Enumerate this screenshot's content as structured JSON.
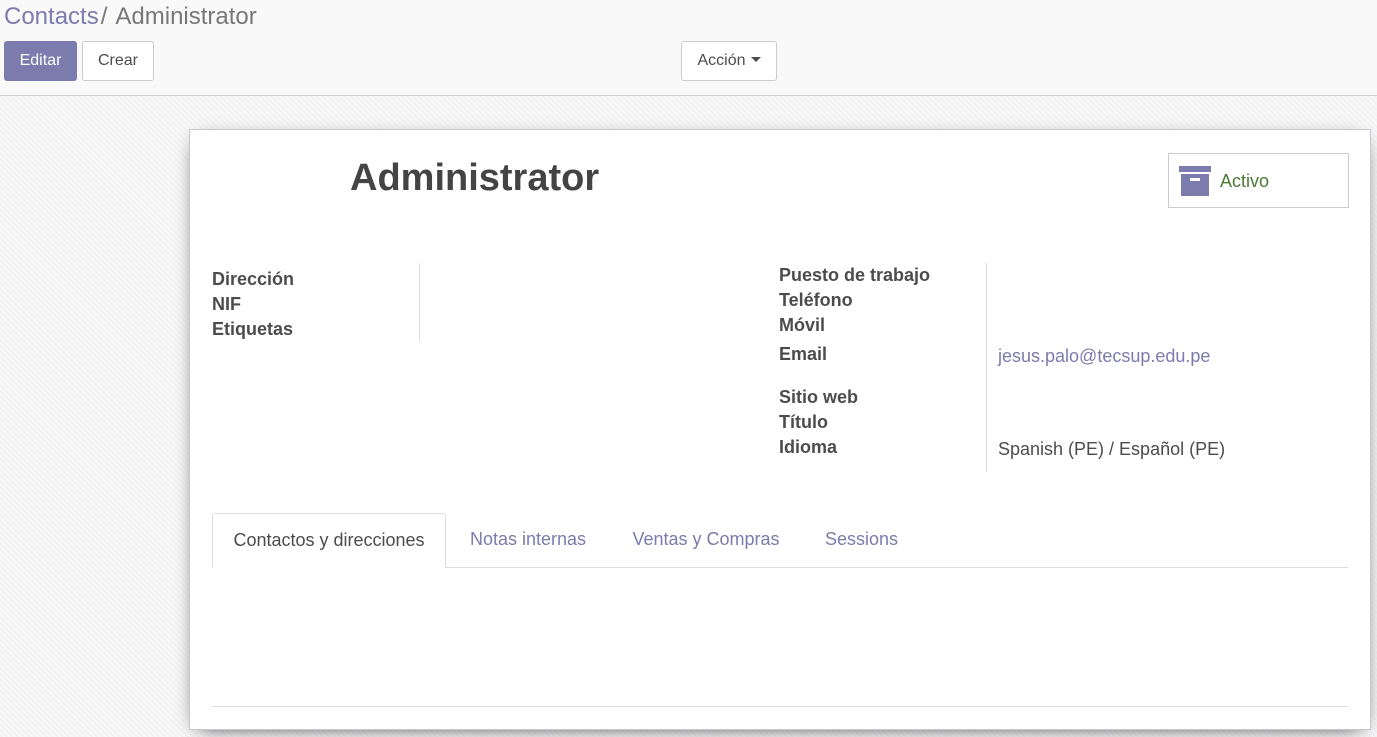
{
  "breadcrumb": {
    "parent": "Contacts",
    "separator": "/",
    "current": "Administrator"
  },
  "toolbar": {
    "edit_label": "Editar",
    "create_label": "Crear",
    "action_label": "Acción"
  },
  "record": {
    "name": "Administrator",
    "status_button_label": "Activo",
    "status_icon": "archive-icon"
  },
  "left_fields": [
    {
      "label": "Dirección",
      "value": ""
    },
    {
      "label": "NIF",
      "value": ""
    },
    {
      "label": "Etiquetas",
      "value": ""
    }
  ],
  "right_fields": {
    "job_position": {
      "label": "Puesto de trabajo",
      "value": ""
    },
    "phone": {
      "label": "Teléfono",
      "value": ""
    },
    "mobile": {
      "label": "Móvil",
      "value": ""
    },
    "email": {
      "label": "Email",
      "value": "jesus.palo@tecsup.edu.pe"
    },
    "website": {
      "label": "Sitio web",
      "value": ""
    },
    "title": {
      "label": "Título",
      "value": ""
    },
    "language": {
      "label": "Idioma",
      "value": "Spanish (PE) / Español (PE)"
    }
  },
  "tabs": [
    {
      "label": "Contactos y direcciones",
      "active": true
    },
    {
      "label": "Notas internas",
      "active": false
    },
    {
      "label": "Ventas y Compras",
      "active": false
    },
    {
      "label": "Sessions",
      "active": false
    }
  ],
  "colors": {
    "brand": "#7c7bad",
    "active_status": "#4a7a33",
    "text": "#4c4c4c"
  }
}
